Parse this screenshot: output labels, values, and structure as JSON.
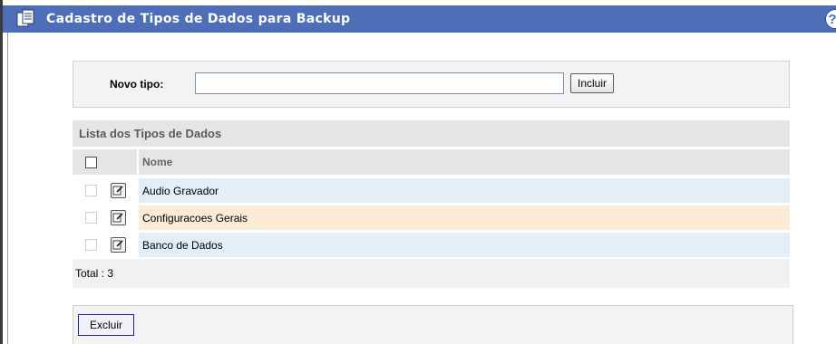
{
  "window": {
    "title": "Cadastro de Tipos de Dados para Backup",
    "help_symbol": "?"
  },
  "new_type": {
    "label": "Novo tipo:",
    "value": "",
    "include_button": "Incluir"
  },
  "list": {
    "title": "Lista dos Tipos de Dados",
    "column_name": "Nome",
    "rows": [
      {
        "name": "Audio Gravador"
      },
      {
        "name": "Configuracoes Gerais"
      },
      {
        "name": "Banco de Dados"
      }
    ],
    "total_label": "Total : 3"
  },
  "actions": {
    "delete_button": "Excluir"
  },
  "colors": {
    "titlebar": "#4e6fb7",
    "row_blue": "#e3eef7",
    "row_orange": "#fcebd6",
    "header_gray": "#e5e5e5"
  },
  "icons": {
    "title": "documents-icon",
    "help": "help-icon",
    "edit": "edit-icon"
  }
}
